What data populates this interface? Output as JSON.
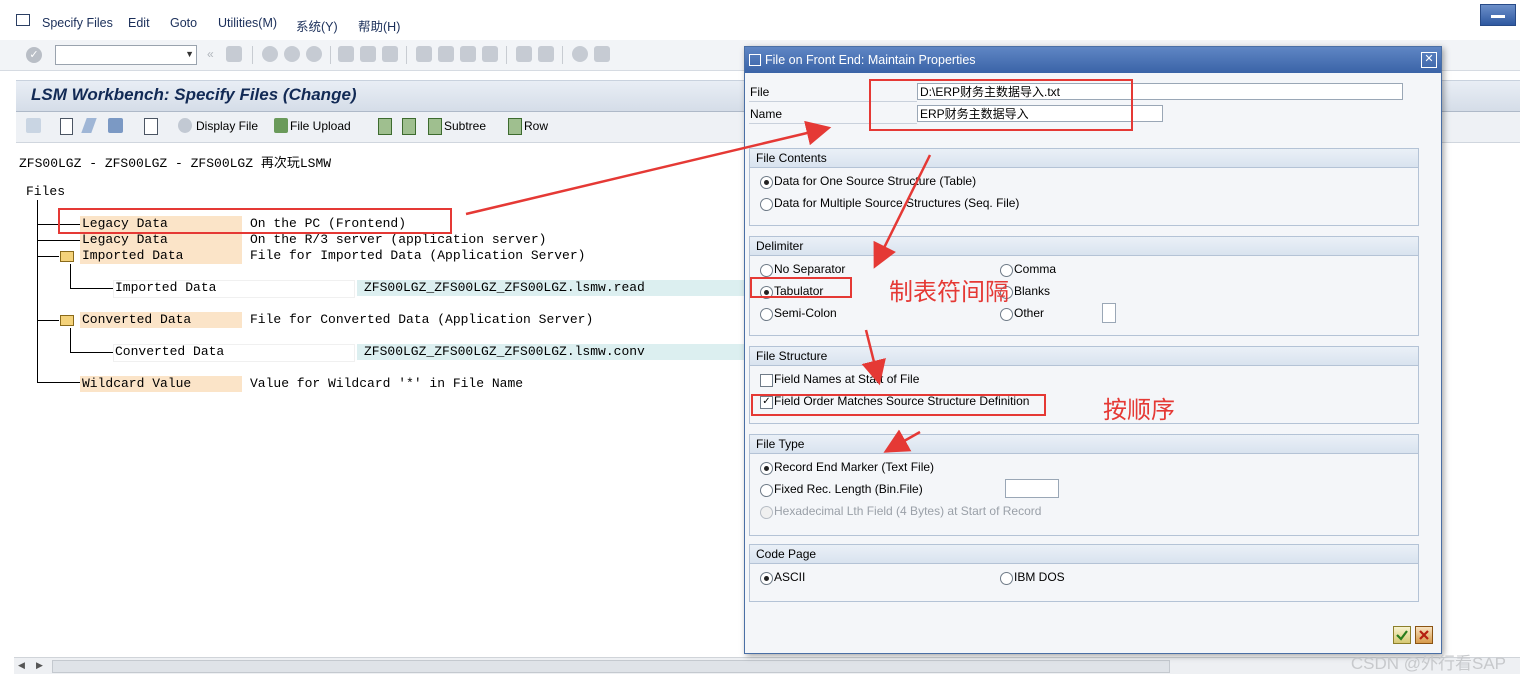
{
  "menubar": {
    "items": [
      {
        "label": "Specify Files"
      },
      {
        "label": "Edit"
      },
      {
        "label": "Goto"
      },
      {
        "label": "Utilities(M)"
      },
      {
        "label": "系统(Y)"
      },
      {
        "label": "帮助(H)"
      }
    ]
  },
  "window": {
    "title": "LSM Workbench: Specify Files (Change)"
  },
  "app_toolbar": {
    "display_file": "Display File",
    "file_upload": "File Upload",
    "subtree": "Subtree",
    "row": "Row"
  },
  "content": {
    "header": "ZFS00LGZ - ZFS00LGZ - ZFS00LGZ 再次玩LSMW",
    "tree_root": "Files",
    "rows": [
      {
        "key": "Legacy Data",
        "desc": "On the PC (Frontend)"
      },
      {
        "key": "Legacy Data",
        "desc": "On the R/3 server (application server)"
      },
      {
        "key": "Imported Data",
        "desc": "File for Imported Data (Application Server)"
      },
      {
        "key": "Imported Data",
        "file": "ZFS00LGZ_ZFS00LGZ_ZFS00LGZ.lsmw.read"
      },
      {
        "key": "Converted Data",
        "desc": "File for Converted Data (Application Server)"
      },
      {
        "key": "Converted Data",
        "file": "ZFS00LGZ_ZFS00LGZ_ZFS00LGZ.lsmw.conv"
      },
      {
        "key": "Wildcard Value",
        "desc": "Value for Wildcard '*' in File Name"
      }
    ]
  },
  "dialog": {
    "title": "File on Front End: Maintain Properties",
    "file_label": "File",
    "file_value": "D:\\ERP财务主数据导入.txt",
    "name_label": "Name",
    "name_value": "ERP财务主数据导入",
    "file_contents": {
      "header": "File Contents",
      "opt1": "Data for One Source Structure (Table)",
      "opt2": "Data for Multiple Source Structures (Seq. File)",
      "selected": 1
    },
    "delimiter": {
      "header": "Delimiter",
      "no_separator": "No Separator",
      "comma": "Comma",
      "tabulator": "Tabulator",
      "blanks": "Blanks",
      "semicolon": "Semi-Colon",
      "other": "Other",
      "selected": "Tabulator"
    },
    "file_structure": {
      "header": "File Structure",
      "field_names": "Field Names at Start of File",
      "field_order": "Field Order Matches Source Structure Definition",
      "field_names_checked": false,
      "field_order_checked": true
    },
    "file_type": {
      "header": "File Type",
      "record_end": "Record End Marker (Text File)",
      "fixed_len": "Fixed Rec. Length (Bin.File)",
      "hex_len": "Hexadecimal Lth Field (4 Bytes) at Start of Record",
      "selected": "Record End Marker (Text File)"
    },
    "code_page": {
      "header": "Code Page",
      "ascii": "ASCII",
      "ibm_dos": "IBM DOS",
      "selected": "ASCII"
    }
  },
  "annotations": {
    "tab_note": "制表符间隔",
    "order_note": "按顺序"
  },
  "watermark": "CSDN @外行看SAP",
  "colors": {
    "annotation_red": "#e53935",
    "title_blue": "#3a63a7",
    "key_cell": "#fbe4c8",
    "file_cell": "#dceff0"
  }
}
